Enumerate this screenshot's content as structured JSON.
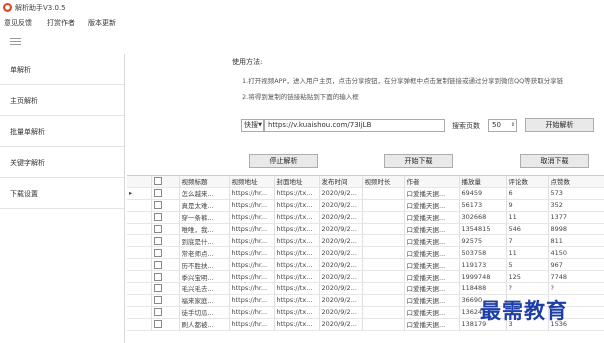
{
  "window": {
    "title": "解析助手V3.0.5"
  },
  "menu": [
    "意见反馈",
    "打赏作者",
    "版本更新"
  ],
  "sidebar": {
    "items": [
      "单解析",
      "主页解析",
      "批量单解析",
      "关键字解析",
      "下载设置"
    ]
  },
  "usage": {
    "title": "使用方法:",
    "lines": [
      "1.打开视频APP，进入用户主页，点击分享按钮，在分享弹框中点击复制链接或通过分享到微信QQ等获取分享链",
      "2.将得到复制的链接粘贴到下面的输入框"
    ]
  },
  "controls": {
    "source": "快搜",
    "url": "https://v.kuaishou.com/73IjLB",
    "pages_label": "搜索页数",
    "pages_value": "50",
    "start_button": "开始解析",
    "stop_button": "停止解析",
    "download_button": "开始下载",
    "cancel_button": "取消下载"
  },
  "table": {
    "columns": [
      "",
      "视频标题",
      "视频地址",
      "封面地址",
      "发布时间",
      "视频时长",
      "作者",
      "播放量",
      "评论数",
      "点赞数"
    ],
    "rows": [
      [
        "",
        "怎么越来...",
        "https://hr...",
        "https://tx...",
        "2020/9/2...",
        "",
        "口爱播天据...",
        "69459",
        "6",
        "573"
      ],
      [
        "",
        "真是太难...",
        "https://hr...",
        "https://tx...",
        "2020/9/2...",
        "",
        "口爱播天据...",
        "56173",
        "9",
        "352"
      ],
      [
        "",
        "穿一条裤...",
        "https://hr...",
        "https://tx...",
        "2020/9/2...",
        "",
        "口爱播天据...",
        "302668",
        "11",
        "1377"
      ],
      [
        "",
        "唯唯，我...",
        "https://hr...",
        "https://tx...",
        "2020/9/2...",
        "",
        "口爱播天据...",
        "1354815",
        "546",
        "8998"
      ],
      [
        "",
        "到底是什...",
        "https://hr...",
        "https://tx...",
        "2020/9/2...",
        "",
        "口爱播天据...",
        "92575",
        "7",
        "811"
      ],
      [
        "",
        "常老师点...",
        "https://hr...",
        "https://tx...",
        "2020/9/2...",
        "",
        "口爱播天据...",
        "503758",
        "11",
        "4150"
      ],
      [
        "",
        "历不胜扶...",
        "https://hr...",
        "https://tx...",
        "2020/9/2...",
        "",
        "口爱播天据...",
        "119173",
        "5",
        "967"
      ],
      [
        "",
        "季兴宝明...",
        "https://hr...",
        "https://tx...",
        "2020/9/2...",
        "",
        "口爱播天据...",
        "1999748",
        "125",
        "7748"
      ],
      [
        "",
        "毛兴毛去...",
        "https://hr...",
        "https://tx...",
        "2020/9/2...",
        "",
        "口爱播天据...",
        "118488",
        "?",
        "?"
      ],
      [
        "",
        "福来家庭...",
        "https://hr...",
        "https://tx...",
        "2020/9/2...",
        "",
        "口爱播天据...",
        "36690",
        "",
        ""
      ],
      [
        "",
        "徒手切瓜...",
        "https://hr...",
        "https://tx...",
        "2020/9/2...",
        "",
        "口爱播天据...",
        "13624",
        "",
        ""
      ],
      [
        "",
        "刷人都被...",
        "https://hr...",
        "https://tx...",
        "2020/9/2...",
        "",
        "口爱播天据...",
        "138179",
        "3",
        "1536"
      ]
    ]
  },
  "watermark": "最需教育"
}
